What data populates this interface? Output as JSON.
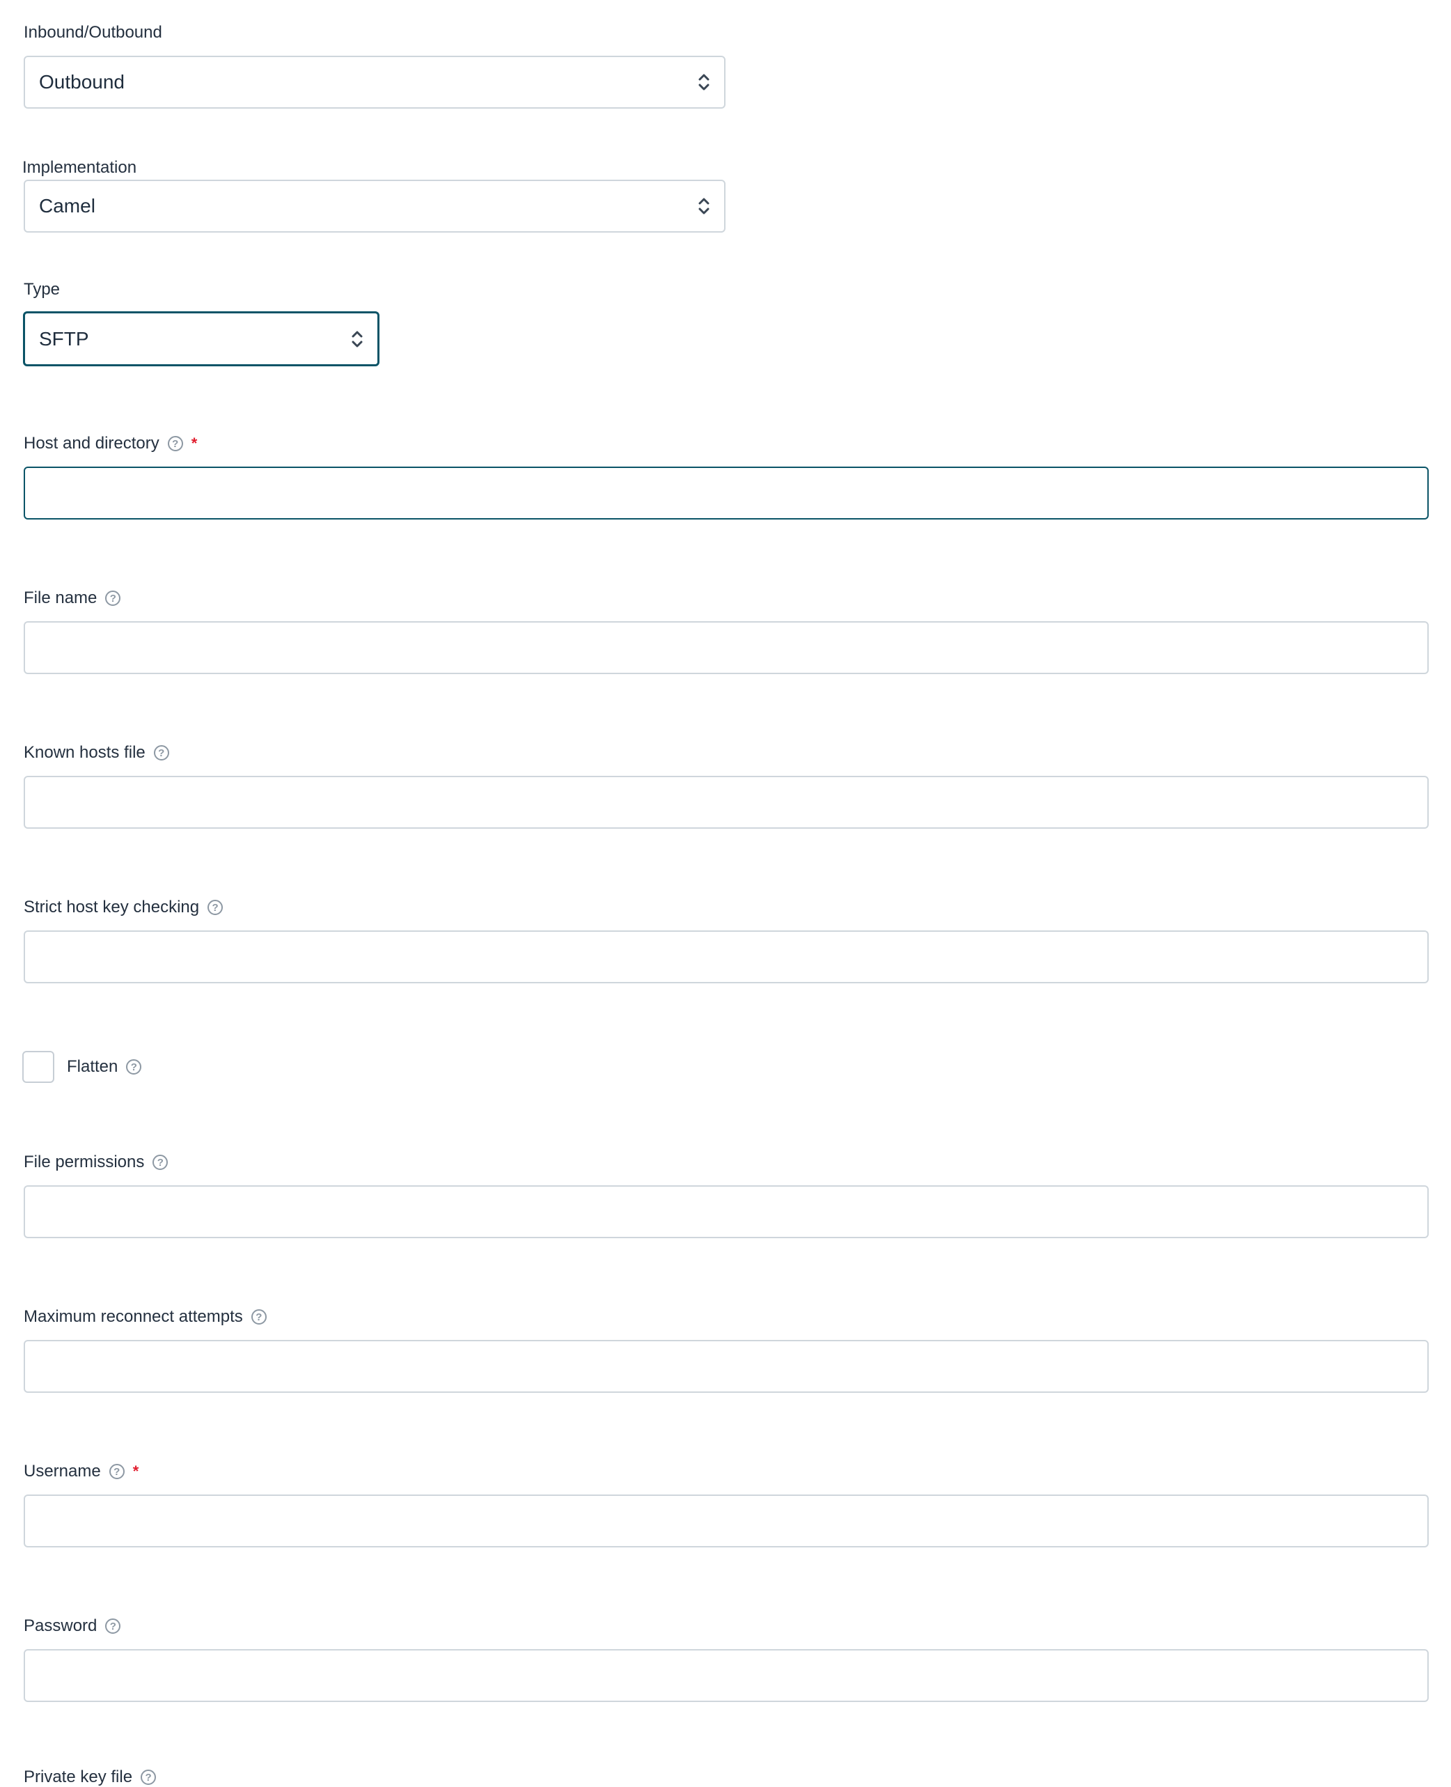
{
  "form": {
    "direction": {
      "label": "Inbound/Outbound",
      "value": "Outbound"
    },
    "implementation": {
      "label": "Implementation",
      "value": "Camel"
    },
    "type": {
      "label": "Type",
      "value": "SFTP"
    },
    "host_directory": {
      "label": "Host and directory",
      "value": "",
      "required_mark": "*"
    },
    "file_name": {
      "label": "File name",
      "value": ""
    },
    "known_hosts": {
      "label": "Known hosts file",
      "value": ""
    },
    "strict_host": {
      "label": "Strict host key checking",
      "value": ""
    },
    "flatten": {
      "label": "Flatten",
      "checked": false
    },
    "file_permissions": {
      "label": "File permissions",
      "value": ""
    },
    "max_reconnect": {
      "label": "Maximum reconnect attempts",
      "value": ""
    },
    "username": {
      "label": "Username",
      "value": "",
      "required_mark": "*"
    },
    "password": {
      "label": "Password",
      "value": ""
    },
    "private_key": {
      "label": "Private key file"
    }
  },
  "icons": {
    "help": "question-circle-icon",
    "select": "chevron-up-down-icon"
  },
  "colors": {
    "focus_border": "#0b5467",
    "required": "#e11d2e",
    "help_icon": "#8d98a3"
  }
}
